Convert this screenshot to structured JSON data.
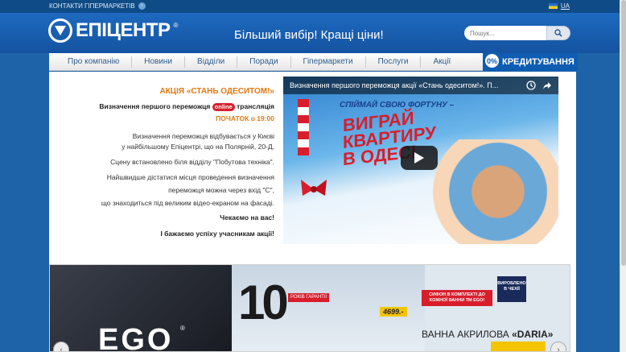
{
  "topbar": {
    "contacts_label": "КОНТАКТИ ГІПЕРМАРКЕТІВ",
    "language": "UA"
  },
  "header": {
    "logo_text": "ЕПІЦЕНТР",
    "slogan": "Більший вибір! Кращі ціни!",
    "search_placeholder": "Пошук..."
  },
  "nav": {
    "items": [
      "Про компанію",
      "Новини",
      "Відділи",
      "Поради",
      "Гіпермаркети",
      "Послуги",
      "Акції"
    ],
    "credit_label": "КРЕДИТУВАННЯ",
    "credit_badge": "0%"
  },
  "promo": {
    "title": "АКЦІЯ «СТАНЬ ОДЕСИТОМ!»",
    "line1_a": "Визначення першого переможця",
    "line1_online": "online",
    "line1_b": "трансляція",
    "start": "ПОЧАТОК о 19:00",
    "p1_l1": "Визначення переможця відбувається у Києві",
    "p1_l2": "у найбільшому Епіцентрі, що на Полярній, 20-Д.",
    "p2": "Сцену встановлено біля відділу \"Побутова техніка\".",
    "p3_l1": "Найшвидше дістатися місця проведення визначення",
    "p3_l2": "переможця можна через вхід \"С\",",
    "p3_l3": "що знаходиться під великим відео-екраном на фасаді.",
    "wait": "Чекаємо на вас!",
    "wish": "І бажаємо успіху учасникам акції!"
  },
  "video": {
    "title": "Визначення першого переможця акції «Стань одеситом!». П...",
    "tagline": "СПІЙМАЙ СВОЮ ФОРТУНУ –",
    "big_line1": "ВИГРАЙ",
    "big_line2": "КВАРТИРУ",
    "big_line3": "В ОДЕСІ"
  },
  "banner": {
    "brand": "EGO",
    "years": "10",
    "years_badge": "РОКІВ ГАРАНТІЇ",
    "siphon_text": "СИФОН В КОМПЛЕКТІ ДО КОЖНОЇ ВАННИ ТМ EGO!",
    "made_text": "ВИРОБЛЕНО В ЧЕХІЇ",
    "price_small": "4699.-",
    "bath_label": "ВАННА АКРИЛОВА",
    "bath_name": "«DARIA»"
  }
}
